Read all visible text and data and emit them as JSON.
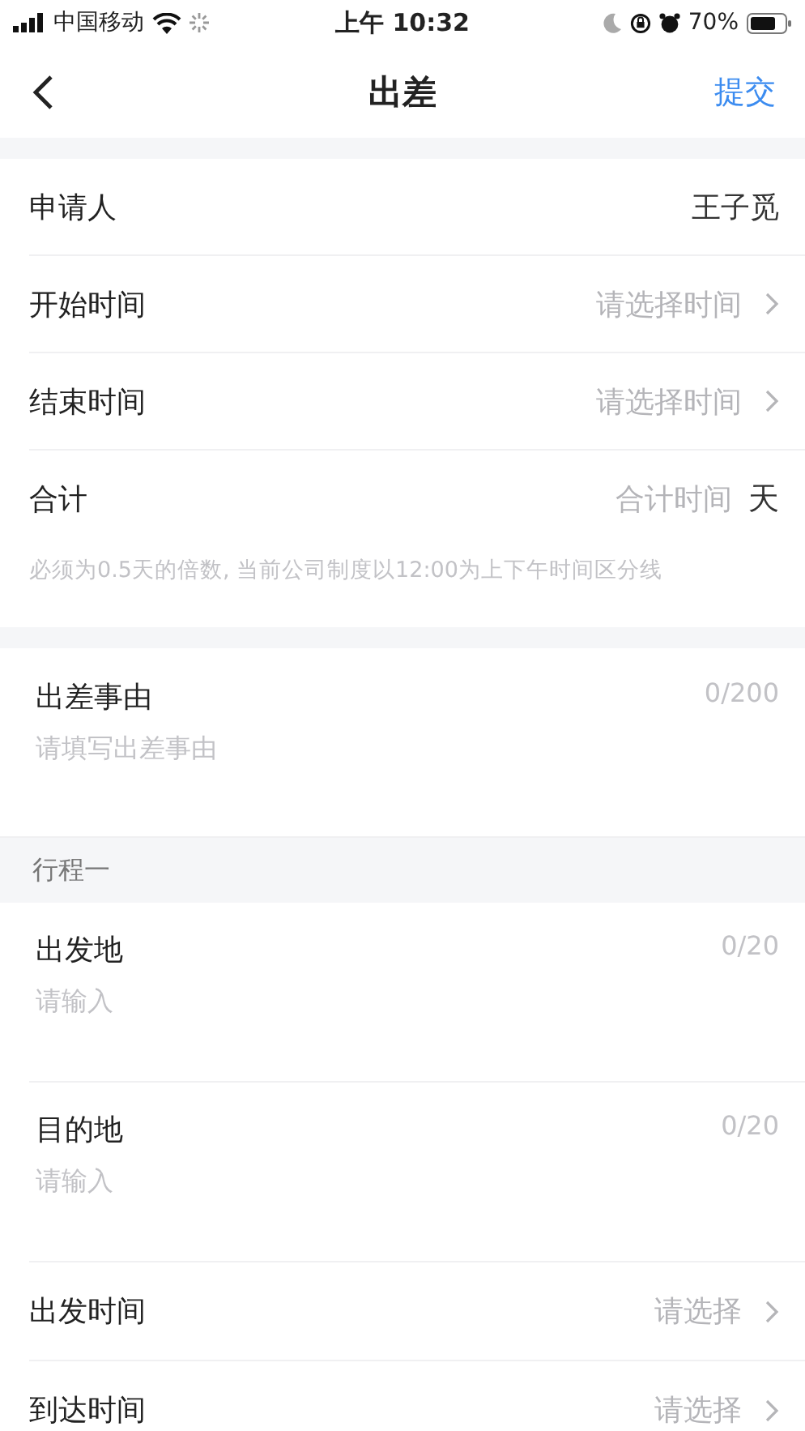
{
  "status_bar": {
    "carrier": "中国移动",
    "time": "上午 10:32",
    "battery": "70%"
  },
  "nav": {
    "title": "出差",
    "action": "提交"
  },
  "fields": [
    {
      "kind": "value",
      "label": "申请人",
      "value": "王子觅"
    },
    {
      "kind": "picker",
      "label": "开始时间",
      "prompt": "请选择时间"
    },
    {
      "kind": "picker",
      "label": "结束时间",
      "prompt": "请选择时间"
    },
    {
      "kind": "total",
      "label": "合计",
      "prompt": "合计时间",
      "unit": "天"
    }
  ],
  "hint": "必须为0.5天的倍数, 当前公司制度以12:00为上下午时间区分线",
  "reason": {
    "label": "出差事由",
    "counter": "0/200",
    "placeholder": "请填写出差事由"
  },
  "trip": {
    "title": "行程一",
    "places": [
      {
        "label": "出发地",
        "counter": "0/20",
        "placeholder": "请输入"
      },
      {
        "label": "目的地",
        "counter": "0/20",
        "placeholder": "请输入"
      }
    ],
    "times": [
      {
        "label": "出发时间",
        "prompt": "请选择"
      },
      {
        "label": "到达时间",
        "prompt": "请选择"
      }
    ]
  }
}
